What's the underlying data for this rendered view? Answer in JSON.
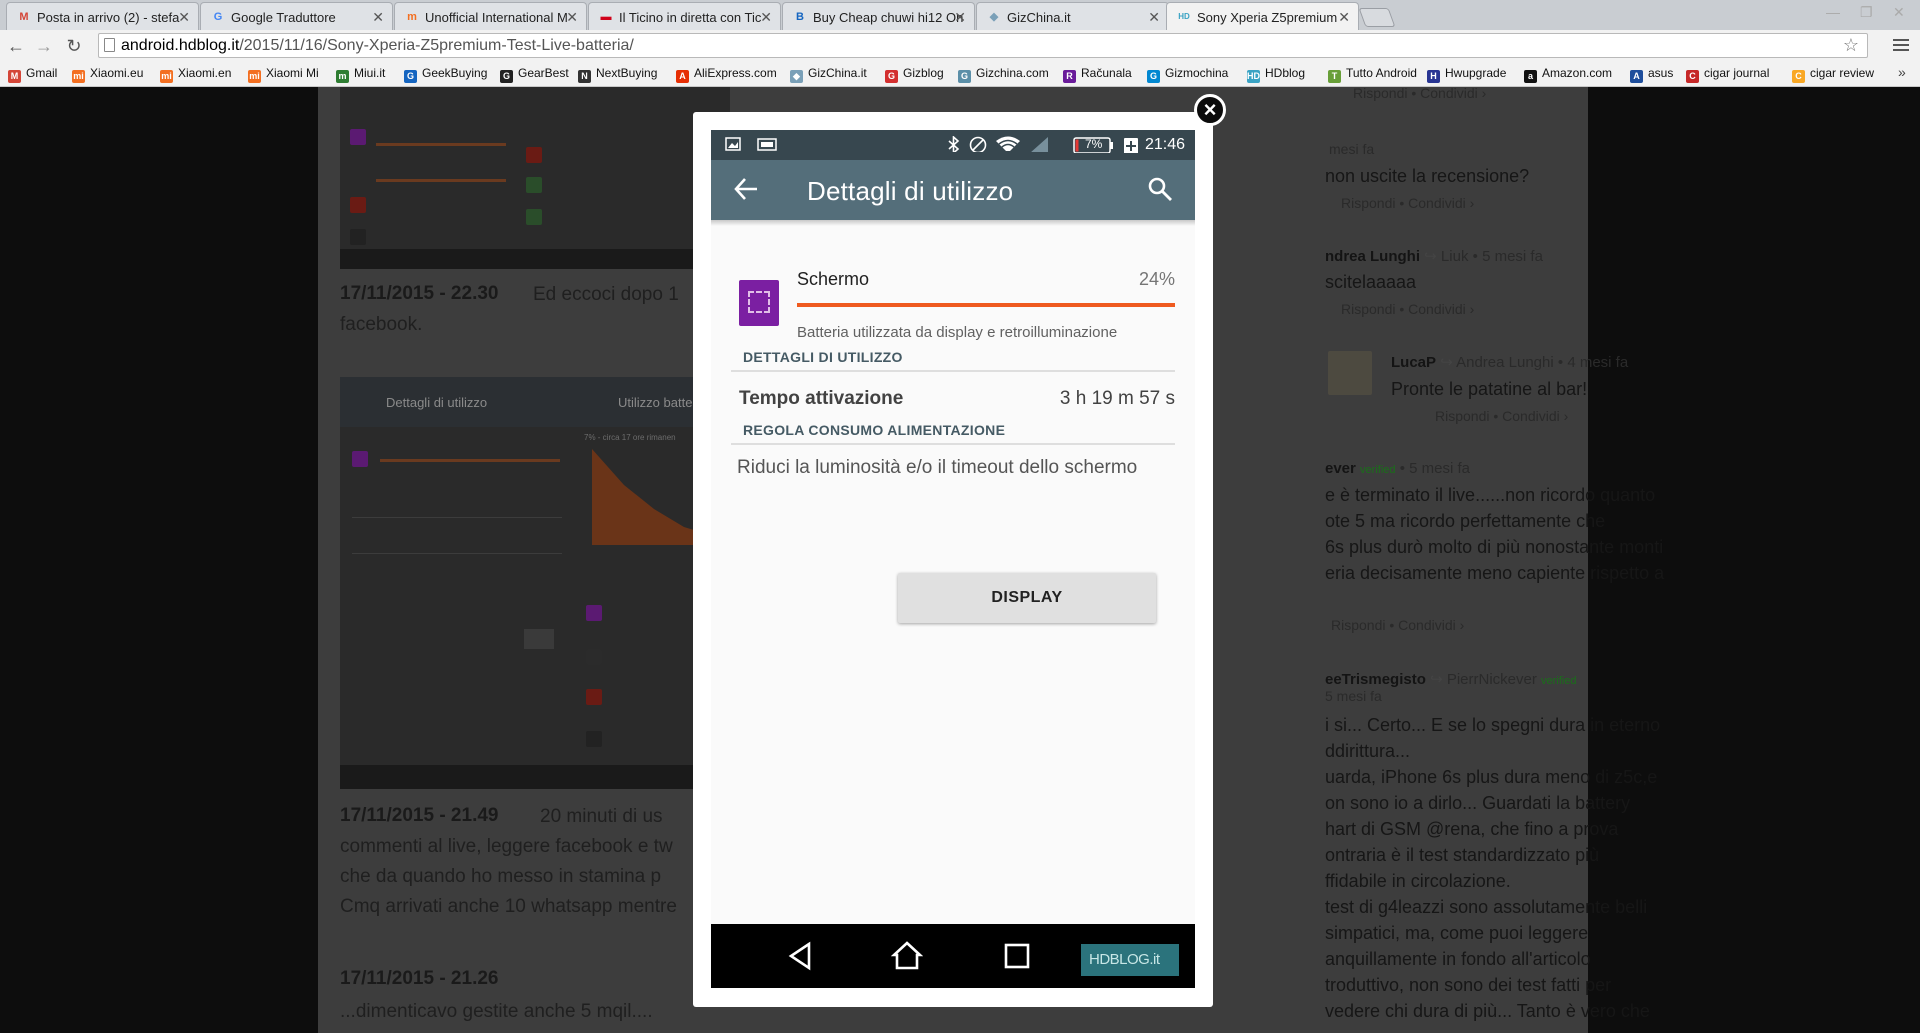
{
  "browser": {
    "tabs": [
      {
        "title": "Posta in arrivo (2) - stefa",
        "icon": "gmail-icon",
        "color": "#d44638",
        "glyph": "M"
      },
      {
        "title": "Google Traduttore",
        "icon": "google-translate-icon",
        "color": "#4285f4",
        "glyph": "G"
      },
      {
        "title": "Unofficial International M",
        "icon": "miui-icon",
        "color": "#f36f21",
        "glyph": "m"
      },
      {
        "title": "Il Ticino in diretta con Tic",
        "icon": "ticino-icon",
        "color": "#d0021b",
        "glyph": "▬"
      },
      {
        "title": "Buy Cheap chuwi hi12 On",
        "icon": "geekbuying-icon",
        "color": "#1565c0",
        "glyph": "B"
      },
      {
        "title": "GizChina.it",
        "icon": "gizchina-icon",
        "color": "#7aa0b8",
        "glyph": "◆"
      },
      {
        "title": "Sony Xperia Z5premium",
        "icon": "hdblog-icon",
        "color": "#3aa3c4",
        "glyph": "HD"
      }
    ],
    "url_host": "android.hdblog.it",
    "url_path": "/2015/11/16/Sony-Xperia-Z5premium-Test-Live-batteria/",
    "bookmarks": [
      {
        "label": "Gmail",
        "color": "#d44638",
        "glyph": "M"
      },
      {
        "label": "Xiaomi.eu",
        "color": "#f36f21",
        "glyph": "mi"
      },
      {
        "label": "Xiaomi.en",
        "color": "#f36f21",
        "glyph": "mi"
      },
      {
        "label": "Xiaomi Mi",
        "color": "#f36f21",
        "glyph": "mi"
      },
      {
        "label": "Miui.it",
        "color": "#2e7d32",
        "glyph": "m"
      },
      {
        "label": "GeekBuying",
        "color": "#1565c0",
        "glyph": "G"
      },
      {
        "label": "GearBest",
        "color": "#222222",
        "glyph": "G"
      },
      {
        "label": "NextBuying",
        "color": "#333333",
        "glyph": "N"
      },
      {
        "label": "AliExpress.com",
        "color": "#e62e04",
        "glyph": "A"
      },
      {
        "label": "GizChina.it",
        "color": "#7aa0b8",
        "glyph": "◆"
      },
      {
        "label": "Gizblog",
        "color": "#d32f2f",
        "glyph": "G"
      },
      {
        "label": "Gizchina.com",
        "color": "#5b8fa8",
        "glyph": "G"
      },
      {
        "label": "Računala",
        "color": "#6a1b9a",
        "glyph": "R"
      },
      {
        "label": "Gizmochina",
        "color": "#0288d1",
        "glyph": "G"
      },
      {
        "label": "HDblog",
        "color": "#3aa3c4",
        "glyph": "HD"
      },
      {
        "label": "Tutto Android",
        "color": "#689f38",
        "glyph": "T"
      },
      {
        "label": "Hwupgrade",
        "color": "#283593",
        "glyph": "H"
      },
      {
        "label": "Amazon.com",
        "color": "#111111",
        "glyph": "a"
      },
      {
        "label": "asus",
        "color": "#1e4e9c",
        "glyph": "A"
      },
      {
        "label": "cigar journal",
        "color": "#c62828",
        "glyph": "C"
      },
      {
        "label": "cigar review",
        "color": "#f9a825",
        "glyph": "C"
      }
    ]
  },
  "article": {
    "post1_date": "17/11/2015 - 22.30",
    "post1_text_a": "Ed eccoci dopo 1",
    "post1_text_b": "facebook.",
    "shot_title_a": "Dettagli di utilizzo",
    "shot_title_b": "Utilizzo batte",
    "shot_pct_note": "7% - circa 17 ore rimanen",
    "post2_date": "17/11/2015 - 21.49",
    "post2_lines": [
      "20 minuti di us",
      "commenti al live, leggere facebook e tw",
      "che da quando ho messo in stamina p",
      "Cmq arrivati anche 10 whatsapp mentre"
    ],
    "post3_date": "17/11/2015 - 21.26",
    "post3_text": "...dimenticavo gestite anche 5 mqil...."
  },
  "comments": {
    "c1_actions": "Rispondi  •  Condividi ›",
    "c2_meta": "mesi fa",
    "c2_text": "non uscite la recensione?",
    "c2_actions": "Rispondi  •  Condividi ›",
    "c3_name": "ndrea Lunghi",
    "c3_reply": "Liuk",
    "c3_time": "5 mesi fa",
    "c3_text": "scitelaaaaa",
    "c3_actions": "Rispondi  •  Condividi ›",
    "c4_name": "LucaP",
    "c4_reply": "Andrea Lunghi",
    "c4_time": "4 mesi fa",
    "c4_text": "Pronte le patatine al bar!",
    "c4_actions": "Rispondi  •  Condividi ›",
    "c5_name": "ever",
    "c5_badge": "verified",
    "c5_time": "5 mesi fa",
    "c5_lines": [
      "e è terminato il live......non ricordo quanto",
      "ote 5 ma ricordo perfettamente che",
      "6s plus durò molto di più nonostante monti",
      "eria decisamente meno capiente rispetto a"
    ],
    "c5_actions": "Rispondi  •  Condividi ›",
    "c6_name": "eeTrismegisto",
    "c6_reply": "PierrNickever",
    "c6_badge": "verified",
    "c6_time": "5 mesi fa",
    "c6_lines": [
      "i si... Certo... E se lo spegni dura in eterno",
      "ddirittura...",
      "uarda, iPhone 6s plus dura meno di z5c,e",
      "on sono io a dirlo... Guardati la battery",
      "hart di GSM @rena, che fino a prova",
      "ontraria è il test standardizzato più",
      "ffidabile in circolazione.",
      "test di g4leazzi sono assolutamente belli",
      "simpatici, ma, come puoi leggere",
      "anquillamente in fondo all'articolo",
      "troduttivo, non sono dei test fatti per",
      "vedere chi dura di più... Tanto è vero che"
    ]
  },
  "phone": {
    "battery_pct": "7%",
    "time": "21:46",
    "title": "Dettagli di utilizzo",
    "app_name": "Schermo",
    "app_pct": "24%",
    "usage_fraction": 1.0,
    "app_desc": "Batteria utilizzata da display e retroilluminazione",
    "section1": "DETTAGLI DI UTILIZZO",
    "row_label": "Tempo attivazione",
    "row_value": "3 h 19 m 57 s",
    "section2": "REGOLA CONSUMO ALIMENTAZIONE",
    "hint": "Riduci la luminosità e/o il timeout dello schermo",
    "button": "DISPLAY",
    "watermark": "HDBLOG.it",
    "colors": {
      "statusbar": "#37474f",
      "actionbar": "#546e7a",
      "accent": "#ef5a1f",
      "app_icon": "#7b1fa2"
    }
  },
  "lightbox": {
    "close": "×"
  }
}
